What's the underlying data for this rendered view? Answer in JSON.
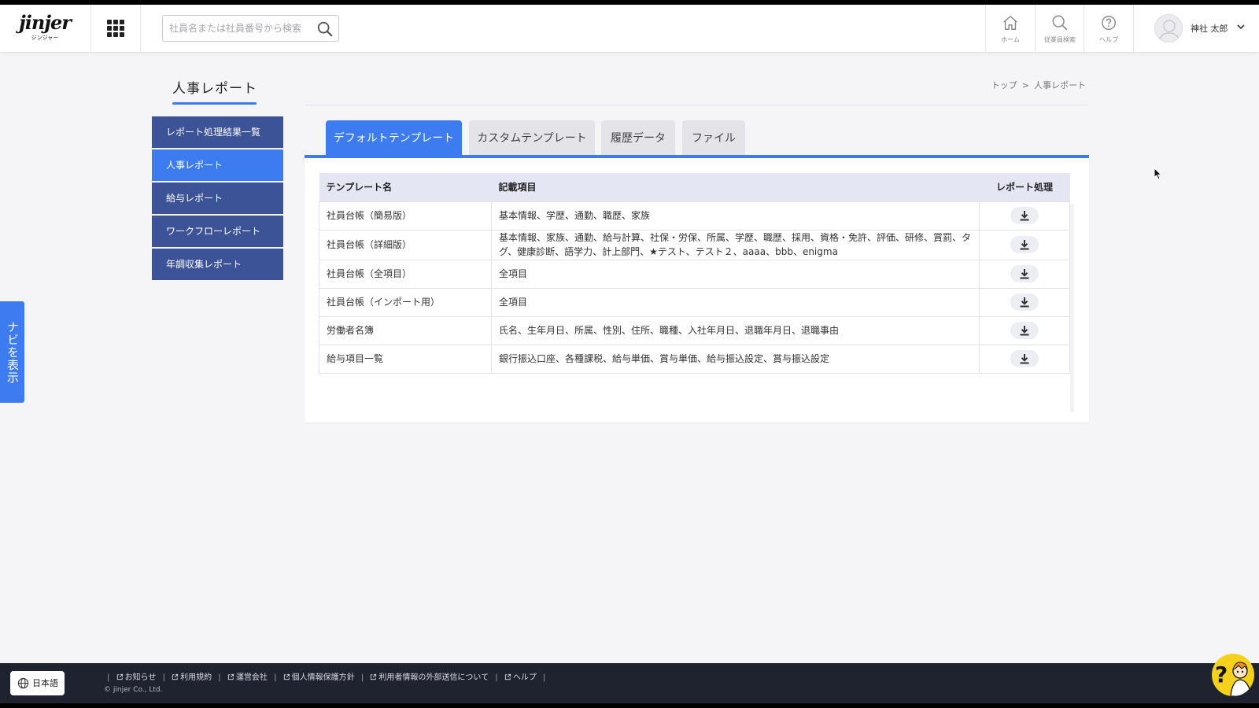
{
  "header": {
    "logo_word": "jinjer",
    "logo_sub": "ジンジャー",
    "search_placeholder": "社員名または社員番号から検索",
    "nav": [
      {
        "label": "ホーム"
      },
      {
        "label": "従業員検索"
      },
      {
        "label": "ヘルプ"
      }
    ],
    "user_name": "神社 太郎"
  },
  "page": {
    "title": "人事レポート",
    "breadcrumb": [
      "トップ",
      ">",
      "人事レポート"
    ]
  },
  "sidebar": {
    "items": [
      {
        "label": "レポート処理結果一覧",
        "active": false
      },
      {
        "label": "人事レポート",
        "active": true
      },
      {
        "label": "給与レポート",
        "active": false
      },
      {
        "label": "ワークフローレポート",
        "active": false
      },
      {
        "label": "年調収集レポート",
        "active": false
      }
    ],
    "navi_toggle": "ナビを表示"
  },
  "tabs": [
    {
      "label": "デフォルトテンプレート",
      "active": true
    },
    {
      "label": "カスタムテンプレート",
      "active": false
    },
    {
      "label": "履歴データ",
      "active": false
    },
    {
      "label": "ファイル",
      "active": false
    }
  ],
  "table": {
    "headers": [
      "テンプレート名",
      "記載項目",
      "レポート処理"
    ],
    "rows": [
      {
        "name": "社員台帳（簡易版）",
        "items": "基本情報、学歴、通勤、職歴、家族"
      },
      {
        "name": "社員台帳（詳細版）",
        "items": "基本情報、家族、通勤、給与計算、社保・労保、所属、学歴、職歴、採用、資格・免許、評価、研修、賞罰、タグ、健康診断、語学力、計上部門、★テスト、テスト２、aaaa、bbb、enigma"
      },
      {
        "name": "社員台帳（全項目）",
        "items": "全項目"
      },
      {
        "name": "社員台帳（インポート用）",
        "items": "全項目"
      },
      {
        "name": "労働者名簿",
        "items": "氏名、生年月日、所属、性別、住所、職種、入社年月日、退職年月日、退職事由"
      },
      {
        "name": "給与項目一覧",
        "items": "銀行振込口座、各種課税、給与単価、賞与単価、給与振込設定、賞与振込設定"
      }
    ]
  },
  "footer": {
    "language": "日本語",
    "links": [
      "お知らせ",
      "利用規約",
      "運営会社",
      "個人情報保護方針",
      "利用者情報の外部送信について",
      "ヘルプ"
    ],
    "copyright": "© jinjer Co., Ltd."
  },
  "colors": {
    "accent": "#3c7bf0",
    "sidebar": "#3d5398",
    "footer": "#1f2330"
  }
}
